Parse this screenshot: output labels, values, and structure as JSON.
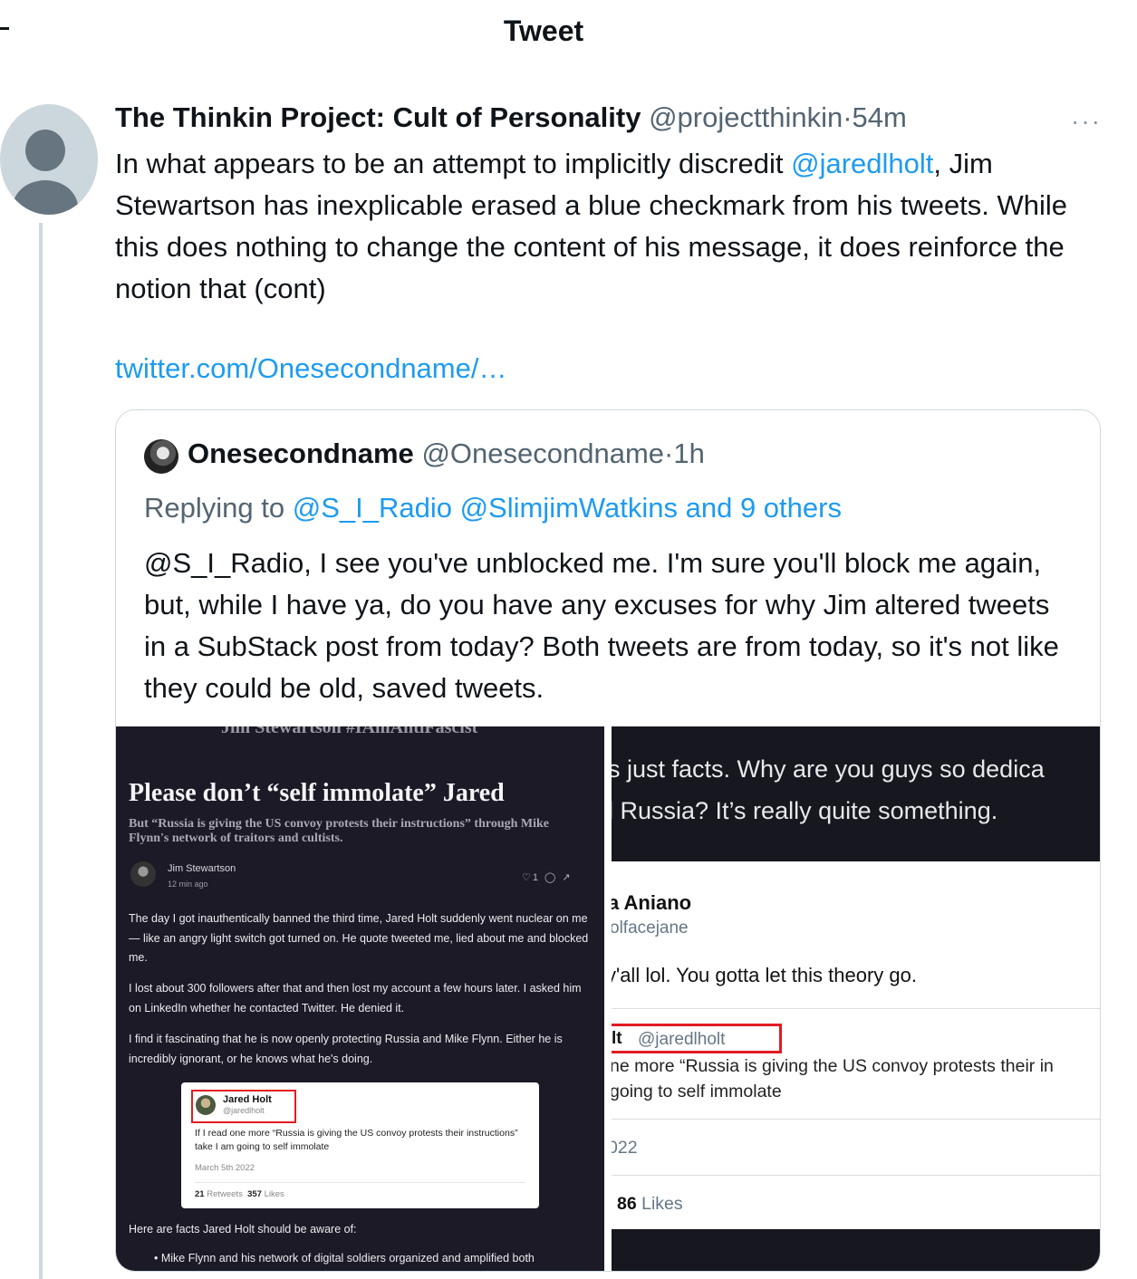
{
  "header": {
    "title": "Tweet"
  },
  "tweet": {
    "author_name": "The Thinkin Project: Cult of Personality",
    "handle": "@projectthinkin",
    "separator": "·",
    "time": "54m",
    "more": "···",
    "text_before_mention": "In what appears to be an attempt to implicitly discredit ",
    "mention": "@jaredlholt",
    "text_after_mention": ", Jim Stewartson has inexplicable erased a blue checkmark from his tweets. While this does nothing to change the content of his message, it does reinforce the notion that (cont)",
    "link": "twitter.com/Onesecondname/…"
  },
  "quote": {
    "author_name": "Onesecondname",
    "handle": "@Onesecondname",
    "separator": "·",
    "time": "1h",
    "replying_prefix": "Replying to ",
    "replying_targets": "@S_I_Radio @SlimjimWatkins and 9 others",
    "text": "@S_I_Radio, I see you've unblocked me. I'm sure you'll block me again, but, while I have ya, do you have any excuses for why Jim altered tweets in a SubStack post from today? Both tweets are from today, so it's not like they could be old, saved tweets."
  },
  "media_left": {
    "cut_header": "Jim Stewartson #IAmAntiFascist",
    "title": "Please don’t “self immolate” Jared",
    "subtitle": "But “Russia is giving the US convoy protests their instructions” through Mike Flynn's network of traitors and cultists.",
    "author": "Jim Stewartson",
    "date": "12 min ago",
    "icons": "♡1 ◯ ↗",
    "para1": "The day I got inauthentically banned the third time, Jared Holt suddenly went nuclear on me — like an angry light switch got turned on. He quote tweeted me, lied about me and blocked me.",
    "para2": "I lost about 300 followers after that and then lost my account a few hours later. I asked him on LinkedIn whether he contacted Twitter. He denied it.",
    "para3": "I find it fascinating that he is now openly protecting Russia and Mike Flynn. Either he is incredibly ignorant, or he knows what he's doing.",
    "embed": {
      "name": "Jared Holt",
      "handle": "@jaredlholt",
      "text": "If I read one more “Russia is giving the US convoy protests their instructions” take I am going to self immolate",
      "date": "March 5th 2022",
      "retweets_count": "21",
      "retweets_label": "Retweets",
      "likes_count": "357",
      "likes_label": "Likes"
    },
    "footer": "Here are facts Jared Holt should be aware of:",
    "bullet": "•  Mike Flynn and his network of digital soldiers organized and amplified both"
  },
  "media_right": {
    "dark_line1": "s just facts. Why are you guys so dedica",
    "dark_line2": "l Russia? It’s really quite something.",
    "name": "a Aniano",
    "handle": "olfacejane",
    "text": "y'all lol. You gotta let this theory go.",
    "box_name": "lt",
    "box_handle": "@jaredlholt",
    "quote_line1": "ne more “Russia is giving the US convoy protests their in",
    "quote_line2": "going to self immolate",
    "date": "022",
    "likes_count": "86",
    "likes_label": "Likes"
  }
}
